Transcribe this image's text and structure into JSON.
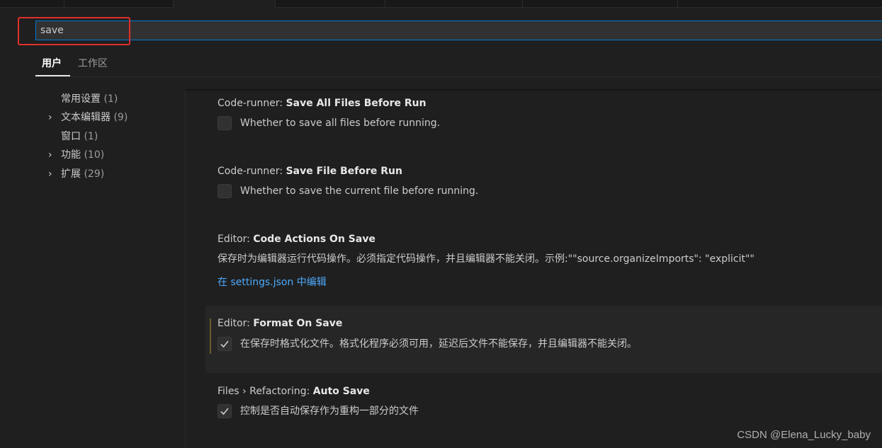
{
  "search": {
    "value": "save"
  },
  "scope_tabs": [
    {
      "label": "用户",
      "active": true
    },
    {
      "label": "工作区",
      "active": false
    }
  ],
  "toc": [
    {
      "label": "常用设置",
      "count": "(1)",
      "expandable": false
    },
    {
      "label": "文本编辑器",
      "count": "(9)",
      "expandable": true
    },
    {
      "label": "窗口",
      "count": "(1)",
      "expandable": false
    },
    {
      "label": "功能",
      "count": "(10)",
      "expandable": true
    },
    {
      "label": "扩展",
      "count": "(29)",
      "expandable": true
    }
  ],
  "settings": [
    {
      "category": "Code-runner: ",
      "name": "Save All Files Before Run",
      "type": "checkbox",
      "checked": false,
      "description": "Whether to save all files before running."
    },
    {
      "category": "Code-runner: ",
      "name": "Save File Before Run",
      "type": "checkbox",
      "checked": false,
      "description": "Whether to save the current file before running."
    },
    {
      "category": "Editor: ",
      "name": "Code Actions On Save",
      "type": "object",
      "description": "保存时为编辑器运行代码操作。必须指定代码操作，并且编辑器不能关闭。示例:\"\"source.organizeImports\": \"explicit\"\"",
      "link": "在 settings.json 中编辑"
    },
    {
      "category": "Editor: ",
      "name": "Format On Save",
      "type": "checkbox",
      "checked": true,
      "modified": true,
      "description": "在保存时格式化文件。格式化程序必须可用，延迟后文件不能保存，并且编辑器不能关闭。"
    },
    {
      "category": "Files › Refactoring: ",
      "name": "Auto Save",
      "type": "checkbox",
      "checked": true,
      "description": "控制是否自动保存作为重构一部分的文件"
    }
  ],
  "colors": {
    "accent_focus": "#0078d4",
    "link": "#4daafc",
    "annotation_red": "#e0302a"
  },
  "watermark": "CSDN @Elena_Lucky_baby"
}
